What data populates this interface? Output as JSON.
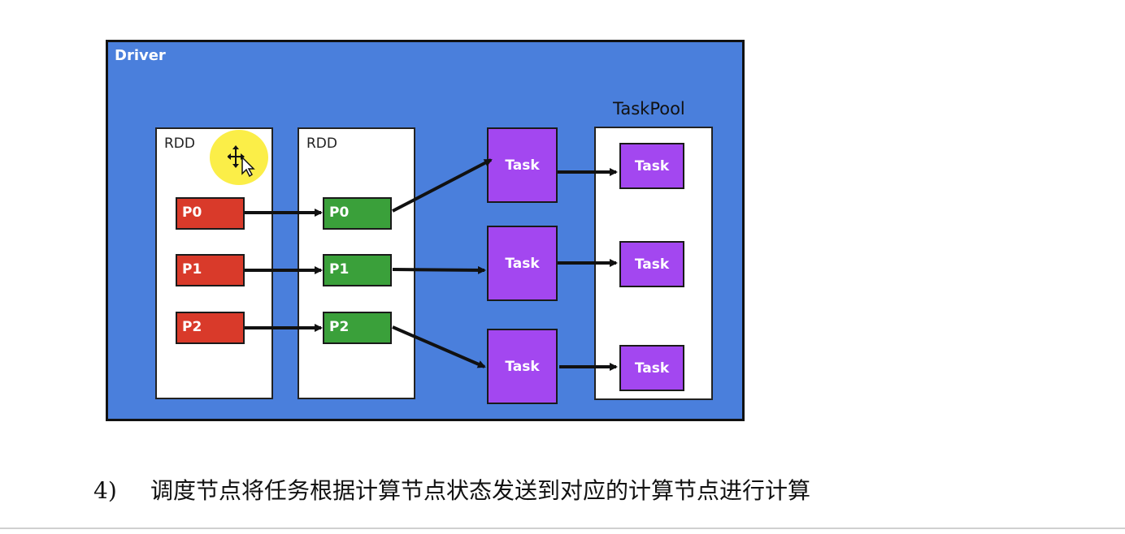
{
  "diagram": {
    "driver_label": "Driver",
    "taskpool_label": "TaskPool",
    "rdd1": {
      "label": "RDD",
      "partitions": [
        "P0",
        "P1",
        "P2"
      ]
    },
    "rdd2": {
      "label": "RDD",
      "partitions": [
        "P0",
        "P1",
        "P2"
      ]
    },
    "tasks": [
      "Task",
      "Task",
      "Task"
    ],
    "pool_tasks": [
      "Task",
      "Task",
      "Task"
    ],
    "colors": {
      "driver_bg": "#4a7fdc",
      "rdd1_partition": "#d93a2a",
      "rdd2_partition": "#3aa03a",
      "task": "#a347f0"
    }
  },
  "cursor": {
    "icon": "move-cursor-icon",
    "highlight": "#faeb28"
  },
  "caption": {
    "number": "4)",
    "text": "调度节点将任务根据计算节点状态发送到对应的计算节点进行计算"
  }
}
